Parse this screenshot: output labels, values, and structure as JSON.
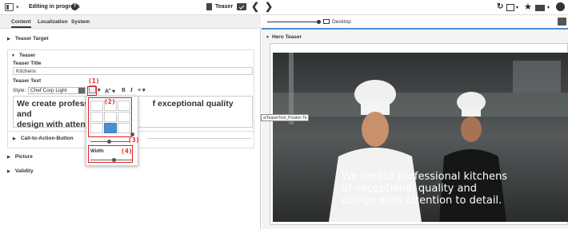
{
  "topbar": {
    "status": "Editing in progress",
    "content_type": "Teaser"
  },
  "tabs": [
    {
      "label": "Content"
    },
    {
      "label": "Localization"
    },
    {
      "label": "System"
    }
  ],
  "sections": {
    "teaser_target": "Teaser Target",
    "teaser": "Teaser",
    "cta": "Call-to-Action-Button",
    "picture": "Picture",
    "validity": "Validity"
  },
  "teaser": {
    "title_label": "Teaser Title",
    "title_value": "Kitchens",
    "text_label": "Teaser Text",
    "style_label": "Style:",
    "style_value": "Chef Corp Light",
    "rte_text_1": "We create professio",
    "rte_text_2": "f exceptional quality and",
    "rte_text_3": "design with attention"
  },
  "popup": {
    "width_label": "Width",
    "selected_cell": [
      2,
      1
    ]
  },
  "annotations": [
    "(1)",
    "(2)",
    "(3)",
    "(4)"
  ],
  "preview": {
    "device": "Desktop",
    "hero_label": "Hero Teaser",
    "hero_text": "We create professional kitchens of exceptional quality and design with attention to detail.",
    "path_label": "a/TeaserText_Positon Te"
  },
  "colors": {
    "accent": "#4a8ed6",
    "annotation": "#e02020"
  }
}
